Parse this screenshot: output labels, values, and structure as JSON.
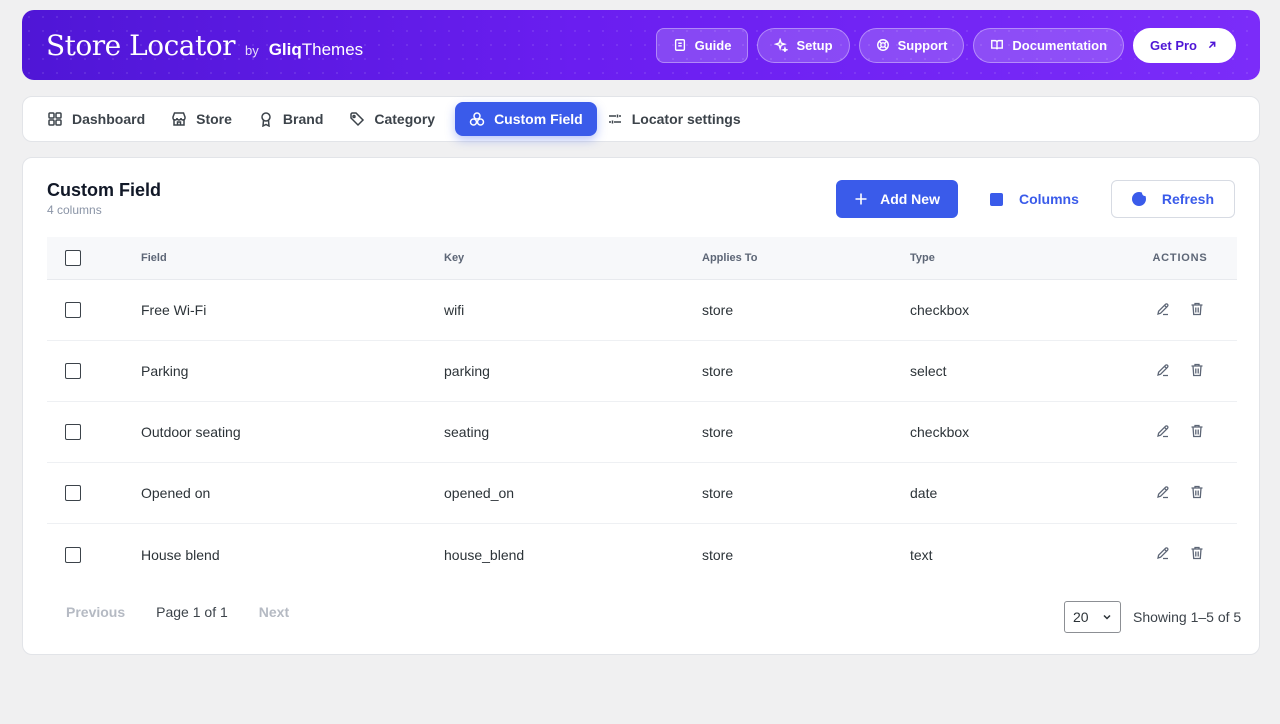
{
  "header": {
    "logo_main": "Store Locator",
    "logo_by": "by",
    "logo_brand_bold": "Gliq",
    "logo_brand_thin": "Themes",
    "actions": [
      {
        "label": "Guide"
      },
      {
        "label": "Setup"
      },
      {
        "label": "Support"
      },
      {
        "label": "Documentation"
      },
      {
        "label": "Get Pro"
      }
    ]
  },
  "tabs": [
    {
      "label": "Dashboard",
      "icon": "grid-icon"
    },
    {
      "label": "Store",
      "icon": "store-icon"
    },
    {
      "label": "Brand",
      "icon": "award-icon"
    },
    {
      "label": "Category",
      "icon": "tag-icon"
    },
    {
      "label": "Custom Field",
      "icon": "shapes-icon",
      "active": true
    },
    {
      "label": "Locator settings",
      "icon": "sliders-icon"
    }
  ],
  "card": {
    "title": "Custom Field",
    "subtitle": "4 columns",
    "add_new": "Add New",
    "columns": "Columns",
    "refresh": "Refresh"
  },
  "table": {
    "headers": {
      "field": "Field",
      "key": "Key",
      "applies": "Applies To",
      "type": "Type",
      "actions": "ACTIONS"
    },
    "rows": [
      {
        "field": "Free Wi-Fi",
        "key": "wifi",
        "applies": "store",
        "type": "checkbox"
      },
      {
        "field": "Parking",
        "key": "parking",
        "applies": "store",
        "type": "select"
      },
      {
        "field": "Outdoor seating",
        "key": "seating",
        "applies": "store",
        "type": "checkbox"
      },
      {
        "field": "Opened on",
        "key": "opened_on",
        "applies": "store",
        "type": "date"
      },
      {
        "field": "House blend",
        "key": "house_blend",
        "applies": "store",
        "type": "text"
      }
    ]
  },
  "pager": {
    "previous": "Previous",
    "info": "Page 1 of 1",
    "next": "Next",
    "per_page": "20",
    "showing": "Showing 1–5 of 5"
  },
  "colors": {
    "accent": "#3a5bea",
    "header_start": "#4f16d6",
    "header_end": "#7b2cf9"
  }
}
